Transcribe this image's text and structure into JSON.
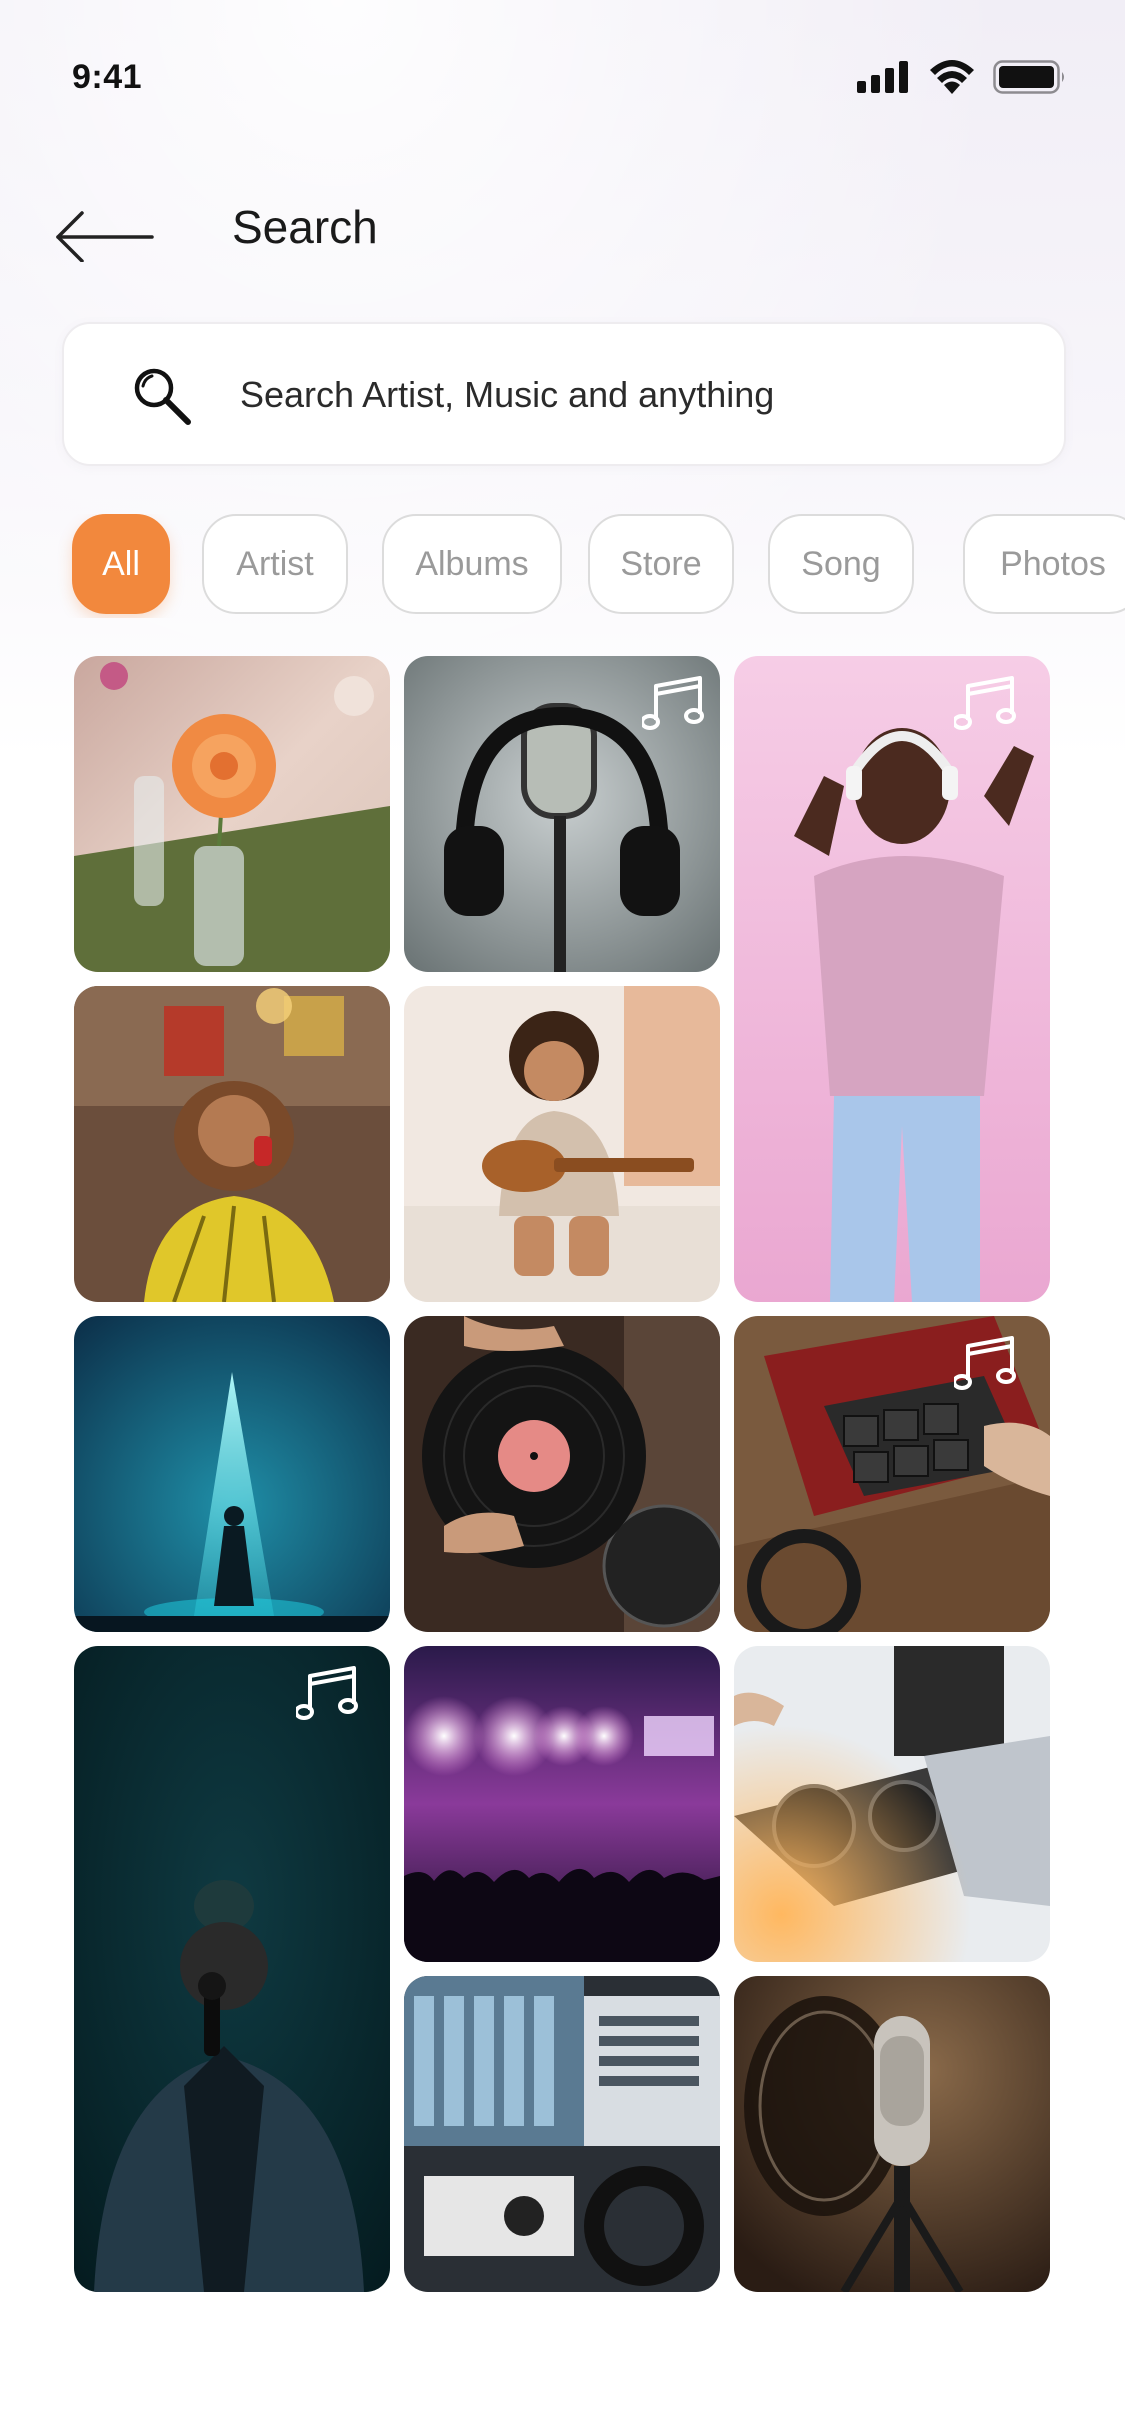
{
  "status_bar": {
    "time": "9:41"
  },
  "header": {
    "title": "Search"
  },
  "search": {
    "placeholder": "Search Artist, Music and anything"
  },
  "chips": [
    {
      "label": "All",
      "active": true
    },
    {
      "label": "Artist",
      "active": false
    },
    {
      "label": "Albums",
      "active": false
    },
    {
      "label": "Store",
      "active": false
    },
    {
      "label": "Song",
      "active": false
    },
    {
      "label": "Photos",
      "active": false
    }
  ],
  "colors": {
    "accent": "#f2883d",
    "chip_border": "#dcdcdc",
    "chip_text": "#9a9a9a",
    "text_primary": "#1a1a1a"
  },
  "grid": [
    {
      "name": "flower-vase-photo",
      "music_note": false
    },
    {
      "name": "headphones-microphone-photo",
      "music_note": true
    },
    {
      "name": "dancing-woman-headphones-photo",
      "music_note": true
    },
    {
      "name": "woman-headphones-cafe-photo",
      "music_note": false
    },
    {
      "name": "child-ukulele-photo",
      "music_note": false
    },
    {
      "name": "spotlight-singer-stage-photo",
      "music_note": false
    },
    {
      "name": "vinyl-record-turntable-photo",
      "music_note": false
    },
    {
      "name": "drum-pad-controller-photo",
      "music_note": true
    },
    {
      "name": "singer-microphone-dark-photo",
      "music_note": true
    },
    {
      "name": "concert-crowd-lights-photo",
      "music_note": false
    },
    {
      "name": "dj-mixer-laptop-photo",
      "music_note": false
    },
    {
      "name": "studio-monitors-headphones-photo",
      "music_note": false
    },
    {
      "name": "condenser-microphone-photo",
      "music_note": false
    }
  ]
}
